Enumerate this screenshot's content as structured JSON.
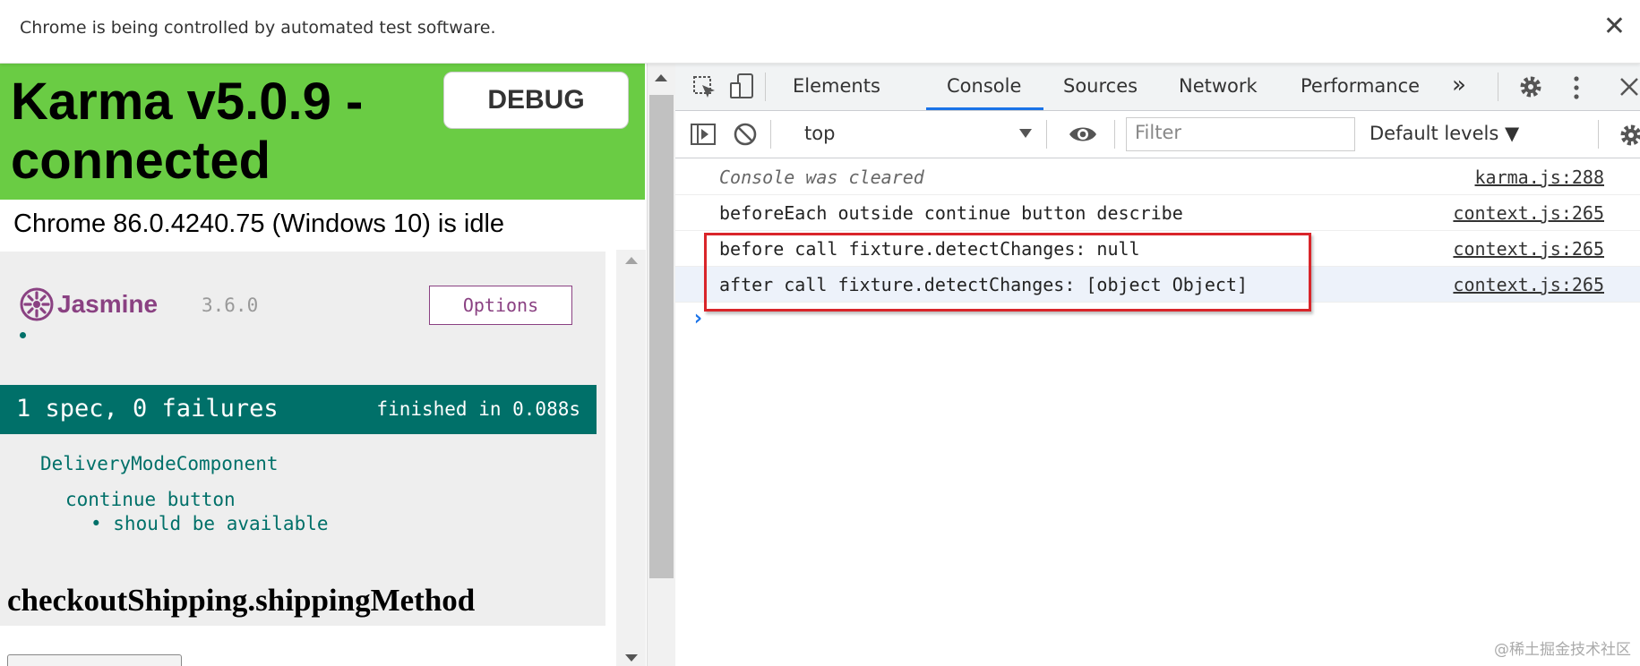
{
  "infobar": {
    "message": "Chrome is being controlled by automated test software.",
    "close_glyph": "✕"
  },
  "karma": {
    "title": "Karma v5.0.9 - connected",
    "debug_label": "DEBUG",
    "status": "Chrome 86.0.4240.75 (Windows 10) is idle",
    "banner_color": "#6acc44"
  },
  "jasmine": {
    "logo_text": "Jasmine",
    "version": "3.6.0",
    "options_label": "Options",
    "summary_left": "1 spec, 0 failures",
    "summary_right": "finished in 0.088s",
    "suite": "DeliveryModeComponent",
    "sub_suite": "continue button",
    "spec": "• should be available",
    "accent_color": "#007069"
  },
  "page_heading": "checkoutShipping.shippingMethod",
  "devtools": {
    "tabs": [
      "Elements",
      "Console",
      "Sources",
      "Network",
      "Performance"
    ],
    "active_tab": "Console",
    "more_tabs_glyph": "»",
    "context_selector": "top",
    "filter_placeholder": "Filter",
    "levels_label": "Default levels ▼",
    "console": [
      {
        "message": "Console was cleared",
        "source": "karma.js:288"
      },
      {
        "message": "beforeEach outside continue button describe",
        "source": "context.js:265"
      },
      {
        "message": "before call fixture.detectChanges: null",
        "source": "context.js:265"
      },
      {
        "message": "after call fixture.detectChanges: [object Object]",
        "source": "context.js:265"
      }
    ],
    "prompt_glyph": "›",
    "highlight_color": "#d9252a"
  },
  "watermark": "@稀土掘金技术社区"
}
